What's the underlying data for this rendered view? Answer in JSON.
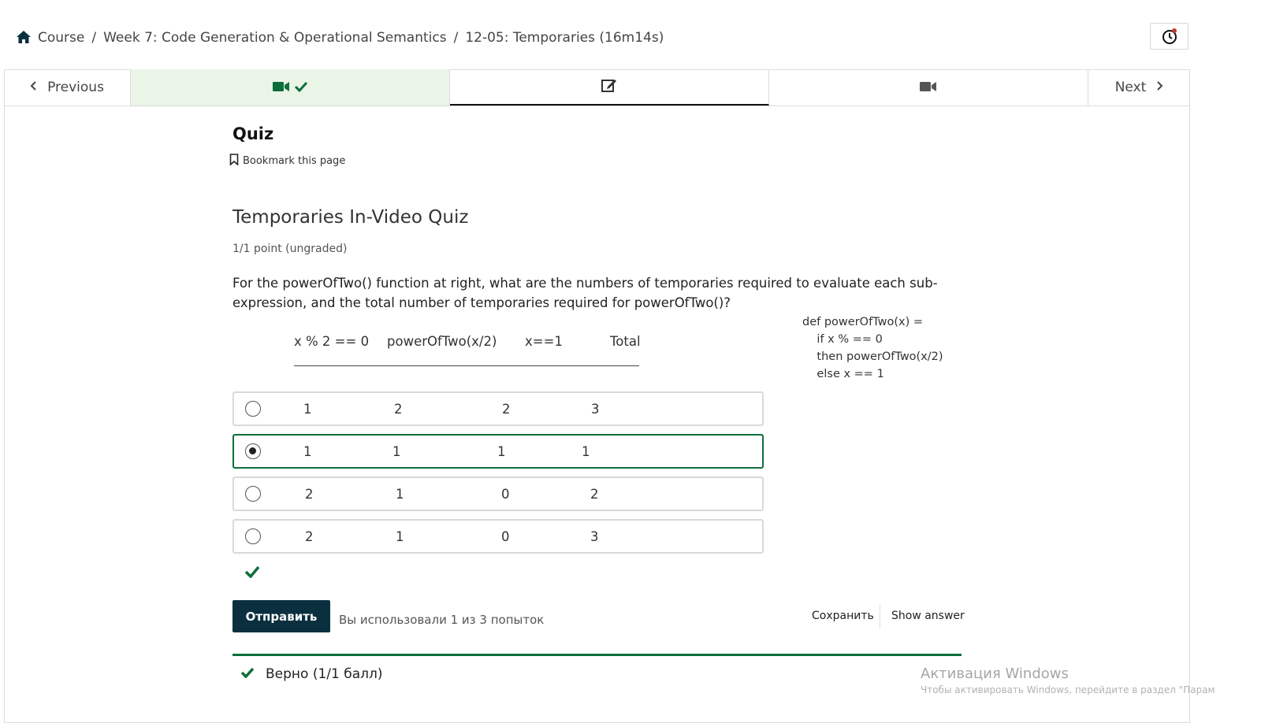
{
  "breadcrumb": {
    "items": [
      "Course",
      "Week 7: Code Generation & Operational Semantics",
      "12-05: Temporaries (16m14s)"
    ],
    "separator": "/"
  },
  "sequence_nav": {
    "previous_label": "Previous",
    "next_label": "Next",
    "units": [
      {
        "icon": "video-icon",
        "completed": true
      },
      {
        "icon": "edit-icon",
        "active": true
      },
      {
        "icon": "video-icon"
      }
    ]
  },
  "unit": {
    "title": "Quiz",
    "bookmark_label": "Bookmark this page"
  },
  "problem": {
    "title": "Temporaries In-Video Quiz",
    "points": "1/1 point (ungraded)",
    "question": "For the powerOfTwo() function at right, what are the numbers of temporaries required to evaluate each sub-expression, and the total number of temporaries required for powerOfTwo()?",
    "code": [
      "def powerOfTwo(x) =",
      "    if x % == 0",
      "    then powerOfTwo(x/2)",
      "    else x == 1"
    ],
    "headers": [
      "x % 2 == 0",
      "powerOfTwo(x/2)",
      "x==1",
      "Total"
    ],
    "header_rule": "________________________________________________",
    "options": [
      {
        "values": [
          "1",
          "2",
          "2",
          "3"
        ],
        "selected": false
      },
      {
        "values": [
          "1",
          "1",
          "1",
          "1"
        ],
        "selected": true
      },
      {
        "values": [
          "2",
          "1",
          "0",
          "2"
        ],
        "selected": false
      },
      {
        "values": [
          "2",
          "1",
          "0",
          "3"
        ],
        "selected": false
      }
    ],
    "submit_label": "Отправить",
    "attempts_text": "Вы использовали 1 из 3 попыток",
    "save_label": "Сохранить",
    "show_answer_label": "Show answer",
    "feedback_text": "Верно (1/1 балл)"
  },
  "watermark": {
    "line1": "Активация Windows",
    "line2": "Чтобы активировать Windows, перейдите в раздел \"Парам"
  },
  "colors": {
    "success_green": "#0d6e3a",
    "completed_tab_bg": "#eaf5e8",
    "submit_bg": "#0a3040"
  }
}
